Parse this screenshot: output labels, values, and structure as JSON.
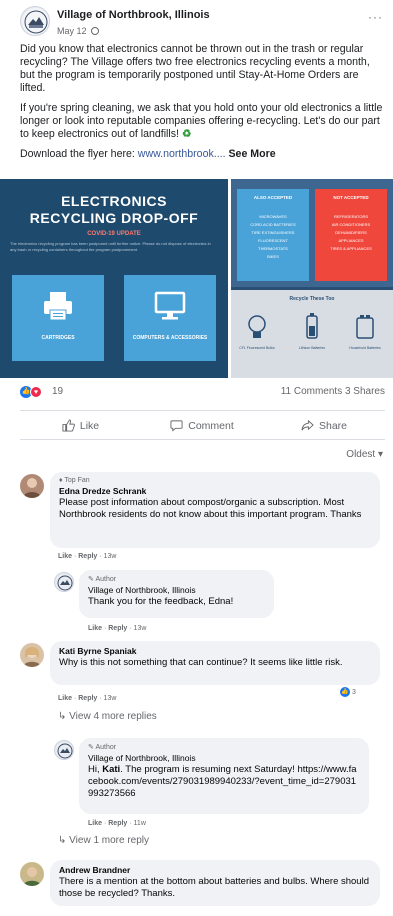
{
  "post": {
    "page_name": "Village of Northbrook, Illinois",
    "date": "May 12",
    "more": "···",
    "paragraph1": "Did you know that electronics cannot be thrown out in the trash or regular recycling? The Village offers two free electronics recycling events a month, but the program is temporarily postponed until Stay-At-Home Orders are lifted.",
    "paragraph2": "If you're spring cleaning, we ask that you hold onto your old electronics a little longer or look into reputable companies offering e-recycling. Let's do our part to keep electronics out of landfills!",
    "recycle_glyph": "♻",
    "flyer_prefix": "Download the flyer here:",
    "flyer_link": "www.northbrook....",
    "see_more": "See More"
  },
  "flyer": {
    "title_line1": "ELECTRONICS",
    "title_line2": "RECYCLING DROP-OFF",
    "covid_update": "COVID-19 UPDATE",
    "note": "The electronics recycling program has been postponed until further notice. Please do not dispose of electronics in any trash or recycling containers throughout the program postponement.",
    "card1_label": "CARTRIDGES",
    "card2_label": "COMPUTERS & ACCESSORIES",
    "accepted_title": "ALSO ACCEPTED",
    "accepted_items": [
      "MICROWAVES",
      "CORD ACID BATTERIES",
      "TIRE EXTINGUISHERS",
      "FLUORESCENT",
      "THERMOSTATS",
      "BIKES"
    ],
    "not_accepted_title": "NOT ACCEPTED",
    "not_accepted_items": [
      "REFRIGERATORS",
      "AIR CONDITIONERS",
      "DEHUMIDIFIERS",
      "APPLIANCES",
      "TIRES & APPLIANCES"
    ],
    "tips_title": "Recycle These Too",
    "tips": [
      "CFL Fluorescent Bulbs",
      "Lithium Batteries",
      "Household Batteries"
    ],
    "accent_blue": "#4aa3d8",
    "accent_red": "#f0473d"
  },
  "engagement": {
    "reaction_count": "19",
    "comments_shares": "11 Comments  3 Shares",
    "like": "Like",
    "comment": "Comment",
    "share": "Share",
    "sort": "Oldest ▾"
  },
  "comments": [
    {
      "badge": "Top Fan",
      "author": "Edna Dredze Schrank",
      "text": "Please post information about compost/organic a subscription. Most Northbrook residents do not know about this important program. Thanks",
      "like": "Like",
      "reply": "Reply",
      "time": "13w"
    },
    {
      "badge": "Author",
      "author": "Village of Northbrook, Illinois",
      "text": "Thank you for the feedback, Edna!",
      "like": "Like",
      "reply": "Reply",
      "time": "13w"
    },
    {
      "author": "Kati Byrne Spaniak",
      "text": "Why is this not something that can continue? It seems like little risk.",
      "like": "Like",
      "reply": "Reply",
      "time": "13w",
      "reaction_count": "3",
      "view_replies": "View 4 more replies"
    },
    {
      "badge": "Author",
      "author": "Village of Northbrook, Illinois",
      "text_prefix": "Hi, ",
      "mention": "Kati",
      "text_rest": ". The program is resuming next Saturday! https://www.facebook.com/events/279031989940233/?event_time_id=279031993273566",
      "like": "Like",
      "reply": "Reply",
      "time": "11w",
      "view_replies": "View 1 more reply"
    },
    {
      "author": "Andrew Brandner",
      "text": "There is a mention at the bottom about batteries and bulbs. Where should those be recycled? Thanks."
    }
  ]
}
